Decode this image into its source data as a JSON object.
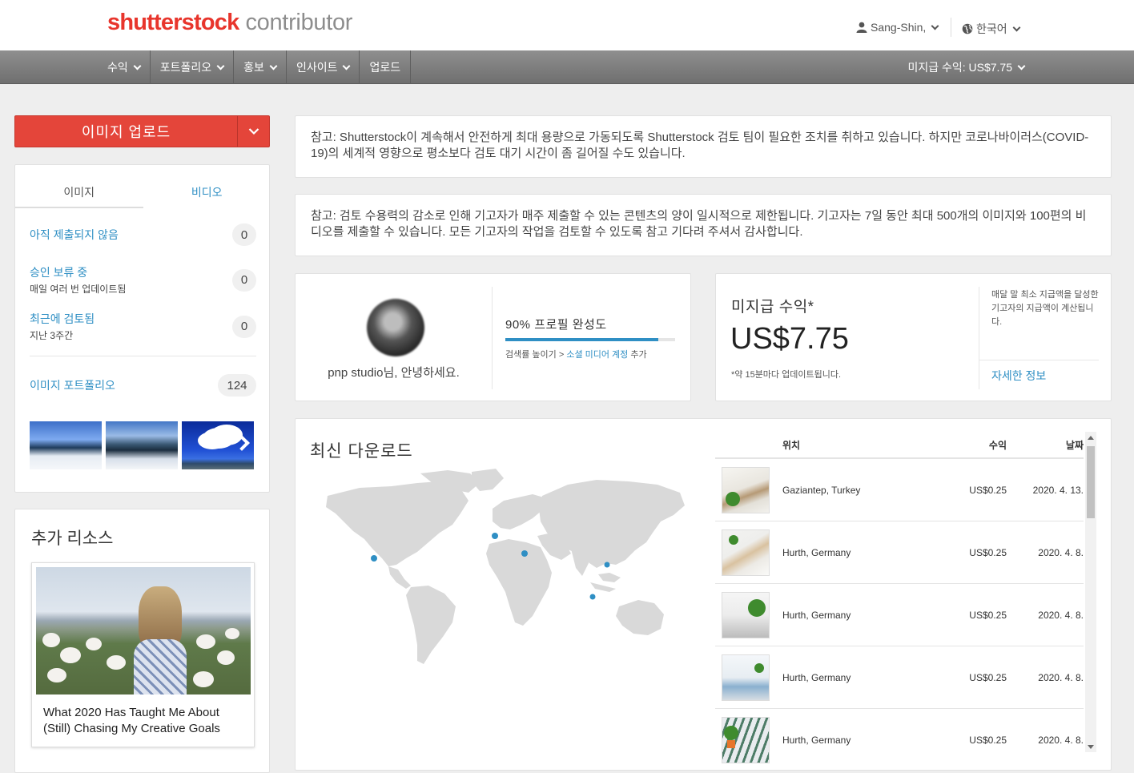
{
  "header": {
    "brand": "shutterstock",
    "brand_sub": "contributor",
    "user": "Sang-Shin,",
    "language": "한국어"
  },
  "nav": {
    "items": [
      {
        "label": "수익",
        "dropdown": true
      },
      {
        "label": "포트폴리오",
        "dropdown": true
      },
      {
        "label": "홍보",
        "dropdown": true
      },
      {
        "label": "인사이트",
        "dropdown": true
      },
      {
        "label": "업로드",
        "dropdown": false
      }
    ],
    "earnings": "미지급 수익: US$7.75"
  },
  "sidebar": {
    "upload_label": "이미지 업로드",
    "tabs": {
      "image": "이미지",
      "video": "비디오"
    },
    "stats": [
      {
        "label": "아직 제출되지 않음",
        "sub": "",
        "count": "0"
      },
      {
        "label": "승인 보류 중",
        "sub": "매일 여러 번 업데이트됨",
        "count": "0"
      },
      {
        "label": "최근에 검토됨",
        "sub": "지난 3주간",
        "count": "0"
      }
    ],
    "portfolio": {
      "label": "이미지 포트폴리오",
      "count": "124"
    }
  },
  "resources": {
    "title": "추가 리소스",
    "post_title": "What 2020 Has Taught Me About (Still) Chasing My Creative Goals"
  },
  "notices": [
    "참고: Shutterstock이 계속해서 안전하게 최대 용량으로 가동되도록 Shutterstock 검토 팀이 필요한 조치를 취하고 있습니다. 하지만 코로나바이러스(COVID-19)의 세계적 영향으로 평소보다 검토 대기 시간이 좀 길어질 수도 있습니다.",
    "참고: 검토 수용력의 감소로 인해 기고자가 매주 제출할 수 있는 콘텐츠의 양이 일시적으로 제한됩니다. 기고자는 7일 동안 최대 500개의 이미지와 100편의 비디오를 제출할 수 있습니다. 모든 기고자의 작업을 검토할 수 있도록 참고 기다려 주셔서 감사합니다."
  ],
  "profile": {
    "greeting": "pnp studio님, 안녕하세요.",
    "completion_label": "90% 프로필 완성도",
    "completion": 0.9,
    "hint_prefix": "검색률 높이기 >",
    "hint_link": "소셜 미디어 계정",
    "hint_suffix": "추가"
  },
  "earnings": {
    "label": "미지급 수익*",
    "amount": "US$7.75",
    "note": "*약 15분마다 업데이트됩니다.",
    "info": "매달 말 최소 지급액을 달성한 기고자의 지급액이 계산됩니다.",
    "more_link": "자세한 정보"
  },
  "downloads": {
    "title": "최신 다운로드",
    "columns": {
      "location": "위치",
      "earnings": "수익",
      "date": "날짜"
    },
    "rows": [
      {
        "location": "Gaziantep, Turkey",
        "earnings": "US$0.25",
        "date": "2020. 4. 13."
      },
      {
        "location": "Hurth, Germany",
        "earnings": "US$0.25",
        "date": "2020. 4. 8."
      },
      {
        "location": "Hurth, Germany",
        "earnings": "US$0.25",
        "date": "2020. 4. 8."
      },
      {
        "location": "Hurth, Germany",
        "earnings": "US$0.25",
        "date": "2020. 4. 8."
      },
      {
        "location": "Hurth, Germany",
        "earnings": "US$0.25",
        "date": "2020. 4. 8."
      }
    ]
  },
  "colors": {
    "accent": "#2f8fc4",
    "brand": "#e8352c",
    "upload": "#e4453a",
    "map_land": "#d9d9d9",
    "map_dot": "#2f8fc4"
  }
}
